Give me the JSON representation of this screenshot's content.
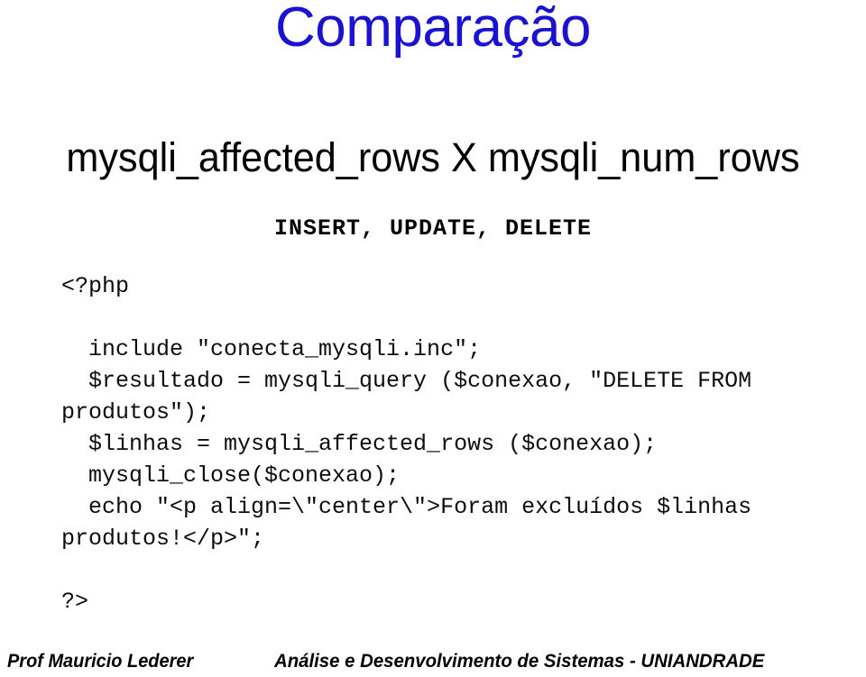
{
  "slide": {
    "title": "Comparação",
    "subtitle": "mysqli_affected_rows X mysqli_num_rows",
    "statement": "INSERT, UPDATE, DELETE",
    "code": {
      "open_tag": "<?php",
      "lines": [
        "include \"conecta_mysqli.inc\";",
        "$resultado = mysqli_query ($conexao, \"DELETE FROM produtos\");",
        "$linhas = mysqli_affected_rows ($conexao);",
        "mysqli_close($conexao);",
        "echo \"<p align=\\\"center\\\">Foram excluídos $linhas produtos!</p>\";"
      ],
      "close_tag": "?>"
    }
  },
  "footer": {
    "author": "Prof Mauricio Lederer",
    "course": "Análise e Desenvolvimento de Sistemas - UNIANDRADE"
  },
  "colors": {
    "title": "#1a12d0",
    "text": "#000000",
    "background": "#ffffff"
  }
}
